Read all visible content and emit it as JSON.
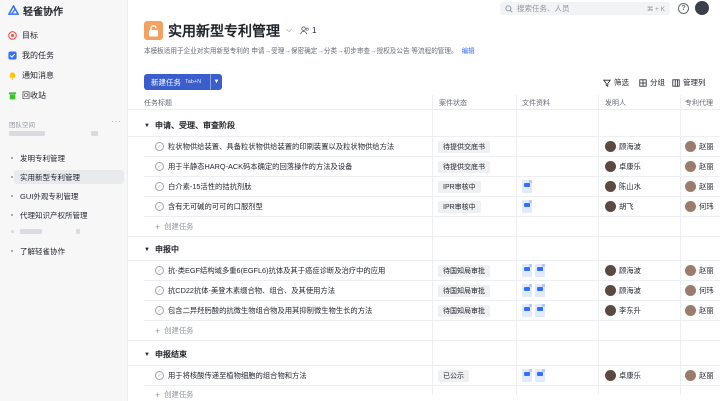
{
  "app": {
    "name": "轻雀协作"
  },
  "sidebar": {
    "nav": [
      {
        "label": "目标",
        "icon": "target-icon",
        "color": "#f54a45"
      },
      {
        "label": "我的任务",
        "icon": "task-icon",
        "color": "#3370ff"
      },
      {
        "label": "通知消息",
        "icon": "bell-icon",
        "color": "#ffc60a"
      },
      {
        "label": "回收站",
        "icon": "trash-icon",
        "color": "#34c724"
      }
    ],
    "team_label": "团队空间",
    "projects": [
      {
        "label": "发明专利管理"
      },
      {
        "label": "实用新型专利管理"
      },
      {
        "label": "GUI外观专利管理"
      },
      {
        "label": "代理知识产权所管理"
      }
    ],
    "learn": "了解轻雀协作"
  },
  "topbar": {
    "search_placeholder": "搜索任务、人员",
    "shortcut": "⌘ + K",
    "help": "?"
  },
  "header": {
    "title": "实用新型专利管理",
    "members": "1",
    "description": "本模板适用于企业对实用新型专利的 申请→受理→保密确定→分类→初步审查→授权及公告 等流程的管理。",
    "edit_label": "编辑"
  },
  "toolbar": {
    "new_task": "新建任务",
    "new_task_shortcut": "Tab+N",
    "filter": "筛选",
    "group": "分组",
    "manage_columns": "管理列"
  },
  "table": {
    "columns": [
      "任务标题",
      "案件状态",
      "文件资料",
      "发明人",
      "专利代理"
    ],
    "create_label": "创建任务",
    "sections": [
      {
        "title": "申请、受理、审查阶段",
        "rows": [
          {
            "name": "粒状物供给装置、具备粒状物供给装置的印刷装置以及粒状物供给方法",
            "status": "待提供交底书",
            "files": 0,
            "inventor": "顾海波",
            "agent": "赵丽"
          },
          {
            "name": "用于半静态HARQ-ACK码本确定的回落操作的方法及设备",
            "status": "待提供交底书",
            "files": 0,
            "inventor": "卓康乐",
            "agent": "赵丽"
          },
          {
            "name": "白介素-15活性的拮抗剂肽",
            "status": "IPR审核中",
            "files": 1,
            "inventor": "陈山水",
            "agent": "赵丽"
          },
          {
            "name": "含有无可碱的可可的口服剂型",
            "status": "IPR审核中",
            "files": 1,
            "inventor": "胡飞",
            "agent": "何玮"
          }
        ]
      },
      {
        "title": "申报中",
        "rows": [
          {
            "name": "抗-类EGF结构域多重6(EGFL6)抗体及其于癌症诊断及治疗中的应用",
            "status": "待国知局审批",
            "files": 2,
            "inventor": "顾海波",
            "agent": "赵丽"
          },
          {
            "name": "抗CD22抗体-美登木素缀合物、组合、及其使用方法",
            "status": "待国知局审批",
            "files": 2,
            "inventor": "顾海波",
            "agent": "何玮"
          },
          {
            "name": "包含二异羟肟酸的抗微生物组合物及用其抑制微生物生长的方法",
            "status": "待国知局审批",
            "files": 2,
            "inventor": "李东升",
            "agent": "赵丽"
          }
        ]
      },
      {
        "title": "申报结束",
        "rows": [
          {
            "name": "用于将核酸传递至植物细胞的组合物和方法",
            "status": "已公示",
            "files": 2,
            "inventor": "卓康乐",
            "agent": "赵丽"
          }
        ]
      }
    ]
  }
}
